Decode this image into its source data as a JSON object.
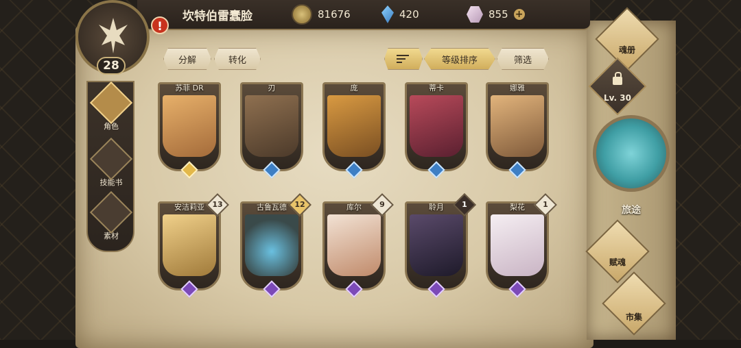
{
  "player": {
    "name": "坎特伯雷蠢脸",
    "level": "28",
    "alert": "!"
  },
  "currencies": {
    "gold": "81676",
    "gems": "420",
    "crystals": "855",
    "add": "+"
  },
  "left_nav": [
    {
      "label": "角色",
      "icon": "character-icon"
    },
    {
      "label": "技能书",
      "icon": "skillbook-icon"
    },
    {
      "label": "素材",
      "icon": "materials-icon"
    }
  ],
  "toolbar": {
    "decompose": "分解",
    "convert": "转化",
    "sort_level": "等级排序",
    "filter": "筛选"
  },
  "cards": [
    {
      "name": "苏菲 DR",
      "count": "",
      "color": "#e0a060"
    },
    {
      "name": "刃",
      "count": "",
      "color": "#8a6a4a"
    },
    {
      "name": "庞",
      "count": "",
      "color": "#c98a3a"
    },
    {
      "name": "蒂卡",
      "count": "",
      "color": "#a83c4c"
    },
    {
      "name": "娜雅",
      "count": "",
      "color": "#d8a870"
    },
    {
      "name": "安洁莉亚",
      "count": "13",
      "color": "#e8c27a"
    },
    {
      "name": "古鲁瓦德",
      "count": "12",
      "color": "#5a8aa8"
    },
    {
      "name": "库尔",
      "count": "9",
      "color": "#e8d4c4"
    },
    {
      "name": "聆月",
      "count": "1",
      "color": "#4a3a5a"
    },
    {
      "name": "梨花",
      "count": "1",
      "color": "#eadce6"
    }
  ],
  "right_nav": {
    "album": "魂册",
    "lock": "Lv. 30",
    "journey": "旅途",
    "soul": "赋魂",
    "market": "市集"
  }
}
